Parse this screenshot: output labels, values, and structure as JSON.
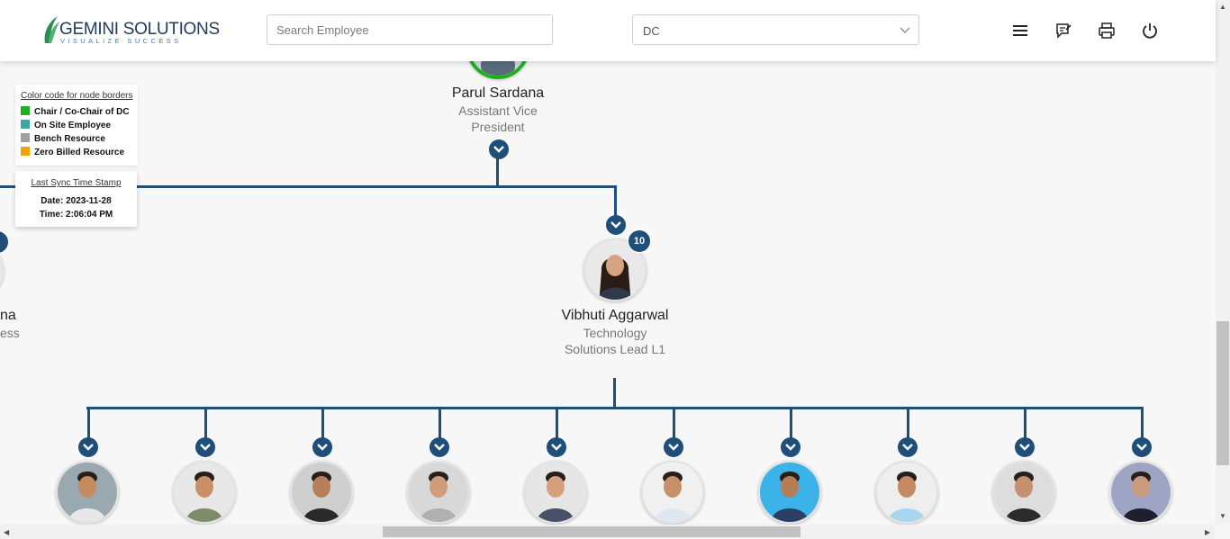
{
  "header": {
    "logo_name": "GEMINI SOLUTIONS",
    "logo_tagline": "VISUALIZE SUCCESS",
    "search_placeholder": "Search Employee",
    "dc_selected": "DC",
    "icons": [
      "menu-icon",
      "feedback-icon",
      "print-icon",
      "power-icon"
    ]
  },
  "legend": {
    "title": "Color code for node borders",
    "items": [
      {
        "label": "Chair / Co-Chair of DC",
        "color": "#1fb01f"
      },
      {
        "label": "On Site Employee",
        "color": "#3aa6a6"
      },
      {
        "label": "Bench Resource",
        "color": "#a0a0a0"
      },
      {
        "label": "Zero Billed Resource",
        "color": "#f2a100"
      }
    ]
  },
  "sync": {
    "title": "Last Sync Time Stamp",
    "date": "Date: 2023-11-28",
    "time": "Time: 2:06:04 PM"
  },
  "nodes": {
    "top": {
      "name": "Parul Sardana",
      "title_line1": "Assistant Vice",
      "title_line2": "President",
      "border_color": "#1fb01f"
    },
    "left_partial": {
      "name_fragment": "na",
      "title_fragment": "ess"
    },
    "manager": {
      "name": "Vibhuti Aggarwal",
      "title_line1": "Technology",
      "title_line2": "Solutions Lead L1",
      "reports_count": "10"
    }
  },
  "children": [
    {
      "bg": "#9aa9b0",
      "skin": "#c68a60",
      "shirt": "#e8e8e8"
    },
    {
      "bg": "#e8e8e8",
      "skin": "#c99067",
      "shirt": "#7d8b68"
    },
    {
      "bg": "#cfcfcf",
      "skin": "#b8805a",
      "shirt": "#2a2a2a"
    },
    {
      "bg": "#d8d8d8",
      "skin": "#d19c78",
      "shirt": "#b0b0b0"
    },
    {
      "bg": "#e6e6e6",
      "skin": "#d6a07a",
      "shirt": "#4a4f6a"
    },
    {
      "bg": "#f0f0f0",
      "skin": "#c8906a",
      "shirt": "#dfe8f0"
    },
    {
      "bg": "#3bb3e8",
      "skin": "#b77e56",
      "shirt": "#2c3e66"
    },
    {
      "bg": "#eeeeee",
      "skin": "#c48a62",
      "shirt": "#a9d6ee"
    },
    {
      "bg": "#dddddd",
      "skin": "#c49070",
      "shirt": "#2b2b2b"
    },
    {
      "bg": "#9fa4c4",
      "skin": "#c99b7e",
      "shirt": "#1e2030"
    }
  ],
  "colors": {
    "connector": "#1f4e79",
    "accent": "#1f4e79"
  }
}
